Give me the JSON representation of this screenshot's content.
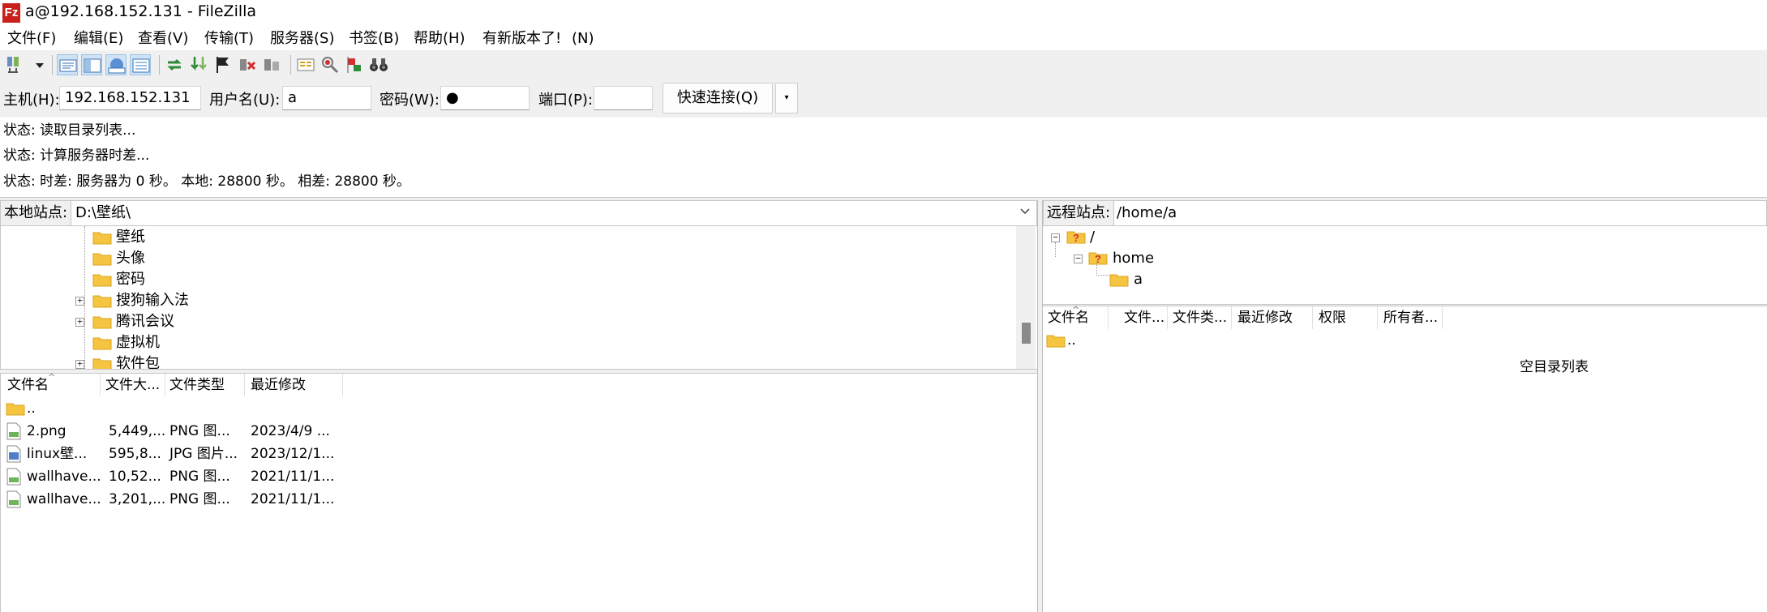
{
  "window": {
    "title": "a@192.168.152.131 - FileZilla",
    "app_icon": "Fz"
  },
  "menu": [
    {
      "label": "文件(F)"
    },
    {
      "label": "编辑(E)"
    },
    {
      "label": "查看(V)"
    },
    {
      "label": "传输(T)"
    },
    {
      "label": "服务器(S)"
    },
    {
      "label": "书签(B)"
    },
    {
      "label": "帮助(H)"
    },
    {
      "label": "有新版本了!"
    },
    {
      "label": "(N)"
    }
  ],
  "toolbar": {
    "icons": [
      "site-manager-icon",
      "dropdown-arrow-icon",
      "toggle-log-icon",
      "toggle-local-tree-icon",
      "toggle-remote-tree-icon",
      "toggle-queue-icon",
      "refresh-icon",
      "process-queue-icon",
      "cancel-icon",
      "disconnect-icon",
      "reconnect-icon",
      "directory-compare-icon",
      "filter-icon",
      "sync-browse-icon",
      "search-icon"
    ]
  },
  "quickconnect": {
    "host_label": "主机(H):",
    "host_value": "192.168.152.131",
    "user_label": "用户名(U):",
    "user_value": "a",
    "pass_label": "密码(W):",
    "pass_value": "●",
    "port_label": "端口(P):",
    "port_value": "",
    "connect_label": "快速连接(Q)",
    "dropdown": "▾"
  },
  "log": [
    "状态: 读取目录列表...",
    "状态: 计算服务器时差...",
    "状态: 时差: 服务器为 0 秒。 本地: 28800 秒。 相差: 28800 秒。"
  ],
  "local": {
    "site_label": "本地站点:",
    "path": "D:\\壁纸\\",
    "tree": [
      {
        "name": "壁纸",
        "expander": ""
      },
      {
        "name": "头像",
        "expander": ""
      },
      {
        "name": "密码",
        "expander": ""
      },
      {
        "name": "搜狗输入法",
        "expander": "+"
      },
      {
        "name": "腾讯会议",
        "expander": "+"
      },
      {
        "name": "虚拟机",
        "expander": ""
      },
      {
        "name": "软件包",
        "expander": "+"
      }
    ],
    "columns": [
      "文件名",
      "文件大...",
      "文件类型",
      "最近修改"
    ],
    "files": [
      {
        "name": "..",
        "size": "",
        "type": "",
        "modified": "",
        "icon": "folder-icon"
      },
      {
        "name": "2.png",
        "size": "5,449,...",
        "type": "PNG 图...",
        "modified": "2023/4/9 ...",
        "icon": "png-file-icon"
      },
      {
        "name": "linux壁...",
        "size": "595,8...",
        "type": "JPG 图片...",
        "modified": "2023/12/1...",
        "icon": "jpg-file-icon"
      },
      {
        "name": "wallhave...",
        "size": "10,52...",
        "type": "PNG 图...",
        "modified": "2021/11/1...",
        "icon": "png-file-icon"
      },
      {
        "name": "wallhave...",
        "size": "3,201,...",
        "type": "PNG 图...",
        "modified": "2021/11/1...",
        "icon": "png-file-icon"
      }
    ]
  },
  "remote": {
    "site_label": "远程站点:",
    "path": "/home/a",
    "tree": [
      {
        "name": "/",
        "expander": "−"
      },
      {
        "name": "home",
        "expander": "−"
      },
      {
        "name": "a",
        "expander": ""
      }
    ],
    "columns": [
      "文件名",
      "文件...",
      "文件类...",
      "最近修改",
      "权限",
      "所有者..."
    ],
    "files": [
      {
        "name": ".."
      }
    ],
    "empty_text": "空目录列表"
  },
  "colors": {
    "folder": "#f5c542",
    "folder_dark": "#e0a820",
    "accent": "#c8201b",
    "toolbar_bg": "#f0f0f0"
  }
}
